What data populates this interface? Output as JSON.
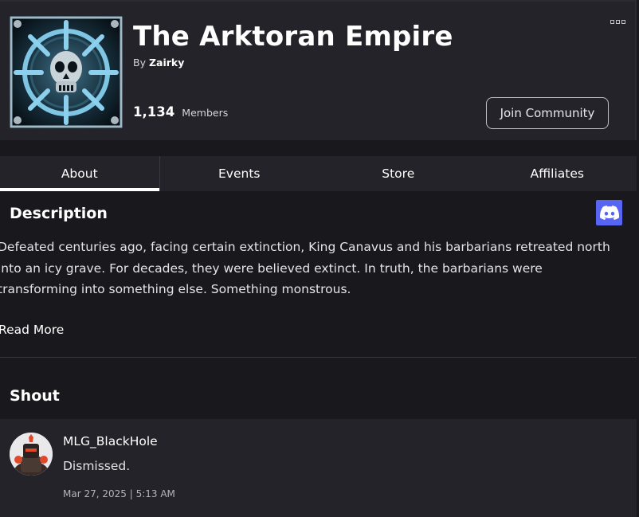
{
  "group": {
    "name": "The Arktoran Empire",
    "by_prefix": "By",
    "owner": "Zairky",
    "member_count": "1,134",
    "member_label": "Members",
    "join_label": "Join Community",
    "emblem_icon": "skull-wheel-emblem"
  },
  "tabs": [
    {
      "label": "About",
      "active": true
    },
    {
      "label": "Events",
      "active": false
    },
    {
      "label": "Store",
      "active": false
    },
    {
      "label": "Affiliates",
      "active": false
    }
  ],
  "about": {
    "description_title": "Description",
    "description_lines": [
      "Defeated centuries ago, facing certain extinction, King Canavus and his barbarians retreated north",
      "into an icy grave. For decades, they were believed extinct. In truth, the barbarians were",
      "transforming into something else. Something monstrous."
    ],
    "read_more": "Read More",
    "social_icon": "discord-icon"
  },
  "shout": {
    "title": "Shout",
    "user": "MLG_BlackHole",
    "message": "Dismissed.",
    "timestamp": "Mar 27, 2025 | 5:13 AM"
  },
  "colors": {
    "page_bg": "#19191d",
    "panel_bg": "#232329",
    "discord": "#5865f2"
  }
}
